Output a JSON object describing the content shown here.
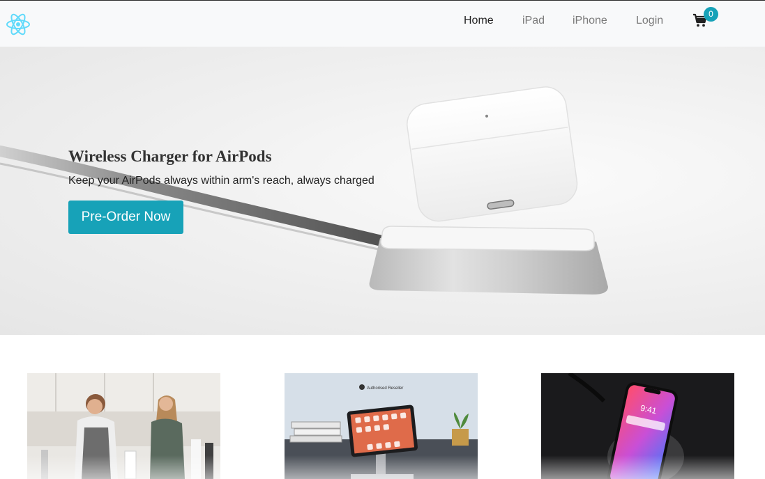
{
  "navbar": {
    "logo_icon": "react-logo-icon",
    "links": [
      {
        "label": "Home",
        "active": true
      },
      {
        "label": "iPad",
        "active": false
      },
      {
        "label": "iPhone",
        "active": false
      },
      {
        "label": "Login",
        "active": false
      }
    ],
    "cart": {
      "icon": "cart-icon",
      "count": "0"
    }
  },
  "hero": {
    "title": "Wireless Charger for AirPods",
    "subtitle": "Keep your AirPods always within arm's reach, always charged",
    "cta_label": "Pre-Order Now",
    "image": "airpods-wireless-charger-image"
  },
  "products": [
    {
      "image": "workshop-people-image"
    },
    {
      "image": "ipad-stand-image",
      "sign_text": "Authorised Reseller"
    },
    {
      "image": "iphone-wireless-charging-image",
      "phone_time": "9:41"
    }
  ],
  "colors": {
    "accent": "#17a2b8",
    "navbar_bg": "#f8f9fa",
    "react_logo": "#61dafb"
  }
}
